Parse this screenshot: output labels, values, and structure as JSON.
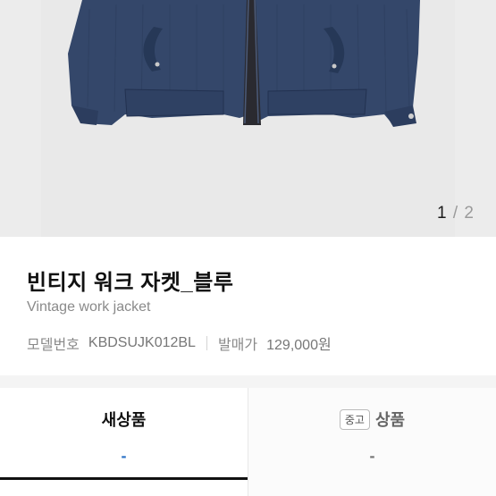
{
  "gallery": {
    "current": "1",
    "separator": "/",
    "total": "2"
  },
  "product": {
    "name_ko": "빈티지 워크 자켓_블루",
    "name_en": "Vintage work jacket",
    "model_label": "모델번호",
    "model_value": "KBDSUJK012BL",
    "price_label": "발매가",
    "price_value": "129,000원"
  },
  "tabs": [
    {
      "label": "새상품",
      "value": "-",
      "selected": true
    },
    {
      "badge": "중고",
      "label": "상품",
      "value": "-",
      "selected": false
    }
  ],
  "colors": {
    "jacket": "#33476b",
    "accent_dash": "#2f74c7"
  }
}
